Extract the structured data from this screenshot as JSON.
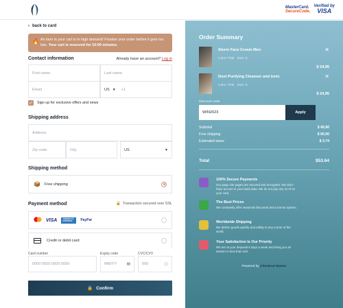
{
  "header": {
    "mastercard_line1": "MasterCard.",
    "mastercard_line2": "SecureCode.",
    "visa_line1": "Verified by",
    "visa_line2": "VISA"
  },
  "back": {
    "label": "back to card"
  },
  "alert": {
    "text": "An item in your cart is in high demand! Finalise your order before it gets too late.",
    "strong": "Your cart is reserved for 10:00 minutes."
  },
  "contact": {
    "title": "Contact information",
    "account_prompt": "Already have an account?",
    "login_link": "Log in",
    "first_name_placeholder": "First name",
    "last_name_placeholder": "Last name",
    "email_placeholder": "Email",
    "country_code": "US",
    "phone_prefix": "+1",
    "signup_label": "Sign up for exclusive offers and news"
  },
  "shipping_address": {
    "title": "Shipping address",
    "address_placeholder": "Address",
    "zip_placeholder": "Zip code",
    "city_placeholder": "City",
    "country": "US"
  },
  "shipping_method": {
    "title": "Shipping method",
    "option": "Free shipping"
  },
  "payment": {
    "title": "Payment method",
    "secured": "Transaction secured over SSL",
    "logos": [
      "VISA",
      "AMERICAN EXPRESS",
      "PayPal"
    ],
    "card_option": "Credit or debit card",
    "card_number_label": "Card number",
    "card_number_placeholder": "0000  0000  0000  0000",
    "expiry_label": "Expiry code",
    "expiry_placeholder": "MM/YY",
    "cvc_label": "CVC/CVV",
    "cvc_placeholder": "000"
  },
  "confirm": {
    "label": "Confirm"
  },
  "summary": {
    "title": "Order Summary",
    "products": [
      {
        "name": "Storm Face Cream Men",
        "color": "Color: Pink",
        "size": "Size: S",
        "price": "$ 24,95"
      },
      {
        "name": "Duet Purifying Cleanser and tonic",
        "color": "Color: Pink",
        "size": "Size: S",
        "price": "$ 24,95"
      }
    ],
    "discount_label": "Discount code",
    "discount_code": "WIN2023",
    "apply_label": "Apply",
    "subtotal_label": "Subtotal",
    "subtotal_value": "$ 49,90",
    "shipping_label": "Free shipping",
    "shipping_value": "$ 00,00",
    "taxes_label": "Estimated taxes",
    "taxes_value": "$ 3.74",
    "total_label": "Total",
    "total_value": "$53.64",
    "features": [
      {
        "title": "100% Secure Payments",
        "desc": "Our page site pages are secured and encrypted. We don't have access to your bank data. We do not pay any vs of on your card."
      },
      {
        "title": "The Best Prices",
        "desc": "We constantly offer seasonal discounts and a bonus system."
      },
      {
        "title": "Worldwide Shipping",
        "desc": "We deliver goods quickly and safely to any corner of the world."
      },
      {
        "title": "Your Satisfaction Is Our Priority",
        "desc": "We are at your disposal 6 days a week and bring you an answer in less than 24h."
      }
    ],
    "powered_by": "Powered by",
    "powered_brand": "Checkout Master"
  },
  "colors": {
    "accent": "#c69576",
    "dark": "#1e3a4c",
    "link": "#c0392b"
  }
}
